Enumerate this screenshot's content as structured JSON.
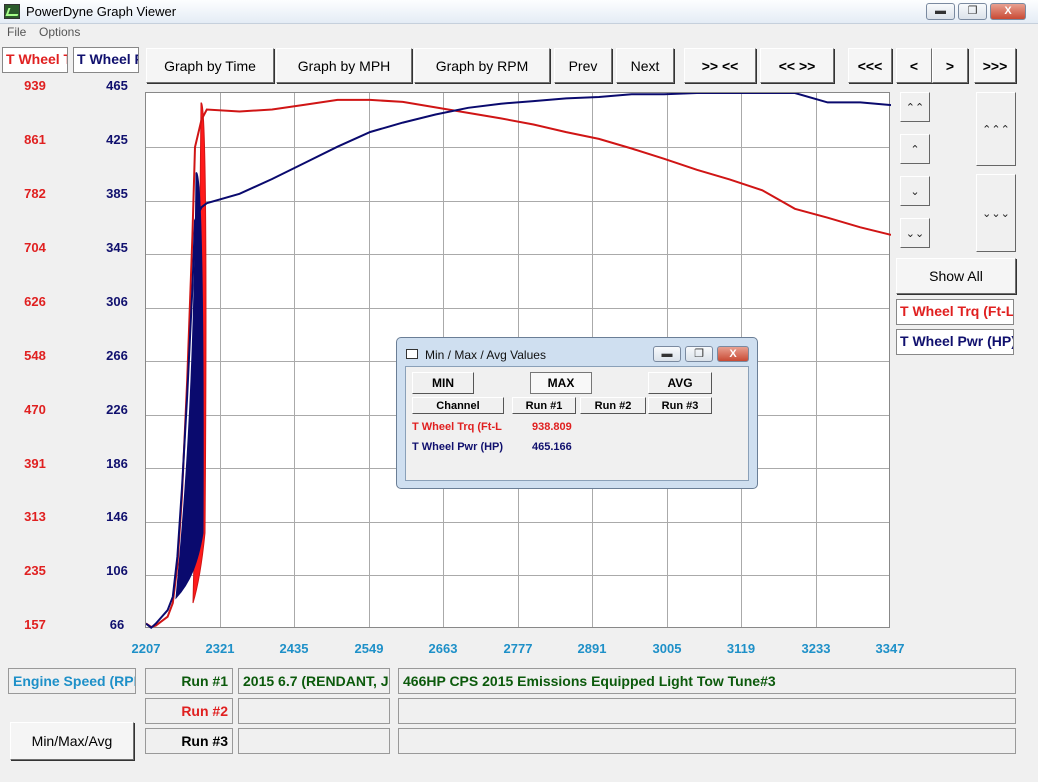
{
  "window": {
    "title": "PowerDyne Graph Viewer",
    "minimize": "▬",
    "maximize": "❐",
    "close": "X"
  },
  "menu": [
    {
      "label": "File"
    },
    {
      "label": "Options"
    }
  ],
  "channel_tabs": [
    {
      "label": "T Wheel Trq (Ft-Lbs)",
      "color": "#e02020"
    },
    {
      "label": "T Wheel Pwr (HP)",
      "color": "#10106e"
    }
  ],
  "toolbar": {
    "graph_by_time": "Graph by Time",
    "graph_by_mph": "Graph by MPH",
    "graph_by_rpm": "Graph by RPM",
    "prev": "Prev",
    "next": "Next",
    "zoom_in": ">> <<",
    "zoom_out": "<< >>",
    "scroll_far_left": "<<<",
    "scroll_left": "<",
    "scroll_right": ">",
    "scroll_far_right": ">>>"
  },
  "chart_data": {
    "type": "line",
    "x_ticks": [
      2207,
      2321,
      2435,
      2549,
      2663,
      2777,
      2891,
      3005,
      3119,
      3233,
      3347
    ],
    "y_left_ticks": [
      939,
      861,
      782,
      704,
      626,
      548,
      470,
      391,
      313,
      235,
      157
    ],
    "y_right_ticks": [
      465,
      425,
      385,
      345,
      306,
      266,
      226,
      186,
      146,
      106,
      66
    ],
    "xlim": [
      2207,
      3347
    ],
    "ylim_left": [
      157,
      939
    ],
    "ylim_right": [
      66,
      465
    ],
    "grid": true,
    "series": [
      {
        "axis": "left",
        "color": "#d01515",
        "x": [
          2207,
          2215,
          2222,
          2240,
          2248,
          2255,
          2262,
          2270,
          2278,
          2282,
          2292,
          2300,
          2350,
          2400,
          2450,
          2500,
          2550,
          2600,
          2650,
          2700,
          2750,
          2800,
          2850,
          2900,
          2950,
          3000,
          3050,
          3100,
          3150,
          3200,
          3250,
          3300,
          3347
        ],
        "y": [
          165,
          160,
          162,
          175,
          195,
          250,
          350,
          520,
          730,
          860,
          900,
          915,
          912,
          915,
          922,
          929,
          929,
          926,
          918,
          910,
          902,
          893,
          882,
          872,
          858,
          843,
          827,
          813,
          797,
          770,
          757,
          743,
          732
        ]
      },
      {
        "axis": "right",
        "color": "#0a0a6e",
        "x": [
          2207,
          2215,
          2222,
          2240,
          2248,
          2255,
          2262,
          2270,
          2278,
          2282,
          2292,
          2300,
          2350,
          2400,
          2450,
          2500,
          2550,
          2600,
          2650,
          2700,
          2750,
          2800,
          2850,
          2900,
          2950,
          3000,
          3050,
          3100,
          3150,
          3200,
          3250,
          3300,
          3347
        ],
        "y": [
          70,
          67,
          70,
          80,
          90,
          120,
          170,
          240,
          320,
          370,
          380,
          383,
          390,
          401,
          413,
          425,
          436,
          443,
          449,
          454,
          457,
          459,
          461,
          462,
          464,
          464,
          465,
          465,
          465,
          465,
          458,
          458,
          456
        ]
      }
    ]
  },
  "scroll_buttons": {
    "top": "⌃⌃",
    "up": "⌃",
    "down": "⌄",
    "bottom": "⌄⌄",
    "page_up": "⌃⌃⌃",
    "page_down": "⌄⌄⌄"
  },
  "show_all": "Show All",
  "legend": [
    {
      "label": "T Wheel Trq (Ft-Lbs)",
      "color": "#e02020"
    },
    {
      "label": "T Wheel Pwr (HP)",
      "color": "#10106e"
    }
  ],
  "bottom": {
    "x_channel": "Engine Speed (RPM)",
    "runs": [
      {
        "label": "Run #1",
        "color": "#0c5a0c",
        "vehicle": "2015 6.7 (RENDANT, J",
        "description": "466HP CPS 2015 Emissions Equipped Light Tow Tune#3"
      },
      {
        "label": "Run #2",
        "color": "#e02020",
        "vehicle": "",
        "description": ""
      },
      {
        "label": "Run #3",
        "color": "#000000",
        "vehicle": "",
        "description": ""
      }
    ],
    "minmax_button": "Min/Max/Avg"
  },
  "dialog": {
    "title": "Min / Max / Avg Values",
    "min": "MIN",
    "max": "MAX",
    "avg": "AVG",
    "headers": [
      "Channel",
      "Run #1",
      "Run #2",
      "Run #3"
    ],
    "rows": [
      {
        "channel": "T Wheel Trq (Ft-L",
        "run1": "938.809",
        "color": "#e02020"
      },
      {
        "channel": "T Wheel Pwr (HP)",
        "run1": "465.166",
        "color": "#10106e"
      }
    ]
  }
}
